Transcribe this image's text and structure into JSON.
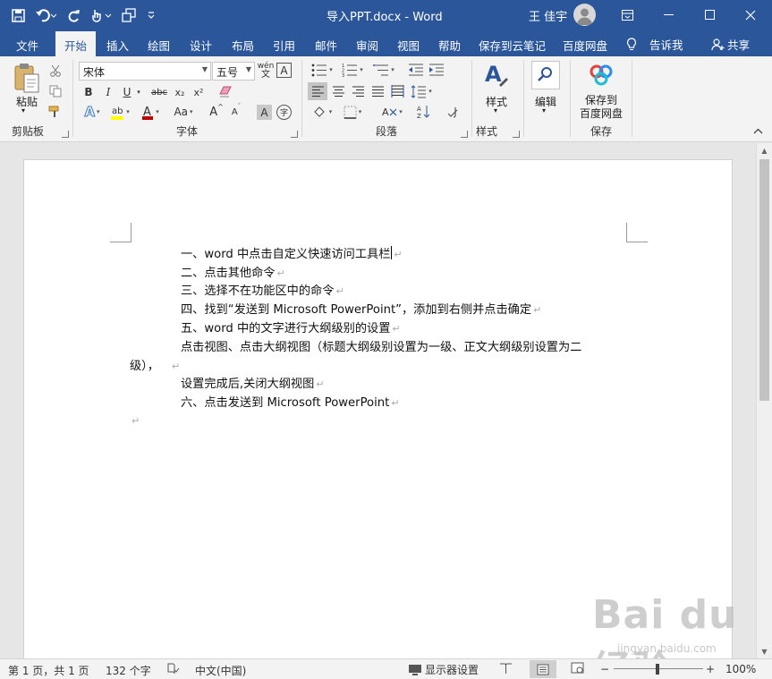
{
  "window": {
    "title": "导入PPT.docx  -  Word",
    "user": "王 佳宇"
  },
  "tabs": [
    "文件",
    "开始",
    "插入",
    "绘图",
    "设计",
    "布局",
    "引用",
    "邮件",
    "审阅",
    "视图",
    "帮助",
    "保存到云笔记",
    "百度网盘"
  ],
  "active_tab": "开始",
  "tell_me": "告诉我",
  "share": "共享",
  "ribbon": {
    "clipboard": {
      "label": "剪贴板",
      "paste": "粘贴"
    },
    "font": {
      "label": "字体",
      "font_name": "宋体",
      "font_size": "五号",
      "wen": "wén",
      "bold": "B",
      "italic": "I",
      "underline": "U",
      "strike": "abc",
      "sub": "x₂",
      "sup": "x²",
      "aa": "Aa",
      "grow": "A",
      "shrink": "A",
      "char_border": "A",
      "enclose": "字"
    },
    "paragraph": {
      "label": "段落"
    },
    "styles": {
      "label": "样式",
      "styles_btn": "样式"
    },
    "editing": {
      "edit_btn": "编辑"
    },
    "save": {
      "label": "保存",
      "line1": "保存到",
      "line2": "百度网盘"
    }
  },
  "document": {
    "lines": [
      "一、word 中点击自定义快速访问工具栏",
      "二、点击其他命令",
      "三、选择不在功能区中的命令",
      "四、找到“发送到 Microsoft PowerPoint”，添加到右侧并点击确定",
      "五、word 中的文字进行大纲级别的设置",
      "点击视图、点击大纲视图（标题大纲级别设置为一级、正文大纲级别设置为二",
      "级），",
      "设置完成后,关闭大纲视图",
      "六、点击发送到 Microsoft PowerPoint"
    ],
    "para_mark": "↵"
  },
  "status": {
    "page": "第 1 页，共 1 页",
    "words": "132 个字",
    "language": "中文(中国)",
    "display_settings": "显示器设置",
    "zoom": "100%",
    "zoom_minus": "−",
    "zoom_plus": "+"
  },
  "watermark": {
    "logo": "Bai du 经验",
    "url": "jingyan.baidu.com"
  },
  "colors": {
    "brand": "#2b579a",
    "ribbon_bg": "#f3f3f3",
    "doc_bg": "#e6e6e6",
    "font_red": "#c00000",
    "highlight_yellow": "#ffff00"
  }
}
